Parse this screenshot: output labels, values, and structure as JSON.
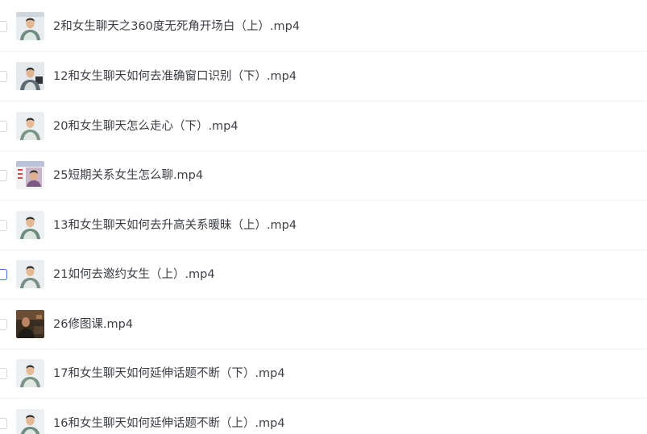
{
  "files": [
    {
      "name": "2和女生聊天之360度无死角开场白（上）.mp4",
      "thumb_icon": "video-thumbnail-person-icon",
      "selected": false
    },
    {
      "name": "12和女生聊天如何去准确窗口识别（下）.mp4",
      "thumb_icon": "video-thumbnail-person-icon",
      "selected": false
    },
    {
      "name": "20和女生聊天怎么走心（下）.mp4",
      "thumb_icon": "video-thumbnail-person-icon",
      "selected": false
    },
    {
      "name": "25短期关系女生怎么聊.mp4",
      "thumb_icon": "video-thumbnail-slide-icon",
      "selected": false
    },
    {
      "name": "13和女生聊天如何去升高关系暖昧（上）.mp4",
      "thumb_icon": "video-thumbnail-person-icon",
      "selected": false
    },
    {
      "name": "21如何去邀约女生（上）.mp4",
      "thumb_icon": "video-thumbnail-person-icon",
      "selected": false
    },
    {
      "name": "26修图课.mp4",
      "thumb_icon": "video-thumbnail-dark-icon",
      "selected": false
    },
    {
      "name": "17和女生聊天如何延伸话题不断（下）.mp4",
      "thumb_icon": "video-thumbnail-person-icon",
      "selected": false
    },
    {
      "name": "16和女生聊天如何延伸话题不断（上）.mp4",
      "thumb_icon": "video-thumbnail-person-icon",
      "selected": false
    }
  ],
  "colors": {
    "text": "#3b3f45",
    "divider": "#eef0f4",
    "checkbox_border": "#d2d6de",
    "checkbox_focus": "#3a6fd8"
  }
}
